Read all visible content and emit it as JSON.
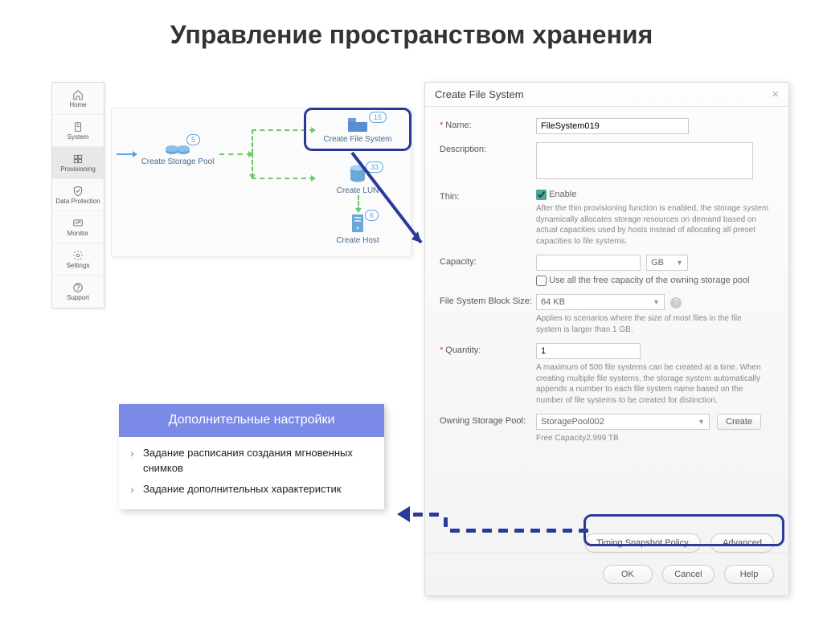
{
  "title": "Управление пространством хранения",
  "sidebar": [
    {
      "label": "Home",
      "icon": "home"
    },
    {
      "label": "System",
      "icon": "server"
    },
    {
      "label": "Provisioning",
      "icon": "provisioning",
      "active": true
    },
    {
      "label": "Data Protection",
      "icon": "shield"
    },
    {
      "label": "Monitor",
      "icon": "monitor"
    },
    {
      "label": "Settings",
      "icon": "gear"
    },
    {
      "label": "Support",
      "icon": "question"
    }
  ],
  "workflow": {
    "pool": {
      "label": "Create Storage Pool",
      "badge": "5"
    },
    "fs": {
      "label": "Create File System",
      "badge": "15"
    },
    "lun": {
      "label": "Create LUN",
      "badge": "33"
    },
    "host": {
      "label": "Create Host",
      "badge": "6"
    }
  },
  "dialog": {
    "title": "Create File System",
    "name_label": "Name:",
    "name_value": "FileSystem019",
    "description_label": "Description:",
    "thin_label": "Thin:",
    "thin_checkbox": "Enable",
    "thin_note": "After the thin provisioning function is enabled, the storage system dynamically allocates storage resources on demand based on actual capacities used by hosts instead of allocating all preset capacities to file systems.",
    "capacity_label": "Capacity:",
    "capacity_unit": "GB",
    "capacity_checkbox": "Use all the free capacity of the owning storage pool",
    "block_label": "File System Block Size:",
    "block_value": "64 KB",
    "block_note": "Applies to scenarios where the size of most files in the file system is larger than 1 GB.",
    "quantity_label": "Quantity:",
    "quantity_value": "1",
    "quantity_note": "A maximum of 500 file systems can be created at a time. When creating multiple file systems, the storage system automatically appends a number to each file system name based on the number of file systems to be created for distinction.",
    "pool_label": "Owning Storage Pool:",
    "pool_value": "StoragePool002",
    "pool_create": "Create",
    "free_capacity": "Free Capacity2.999 TB",
    "timing_btn": "Timing Snapshot Policy",
    "advanced_btn": "Advanced",
    "ok": "OK",
    "cancel": "Cancel",
    "help": "Help"
  },
  "extra": {
    "header": "Дополнительные настройки",
    "items": [
      "Задание расписания создания мгновенных снимков",
      "Задание дополнительных характеристик"
    ]
  }
}
